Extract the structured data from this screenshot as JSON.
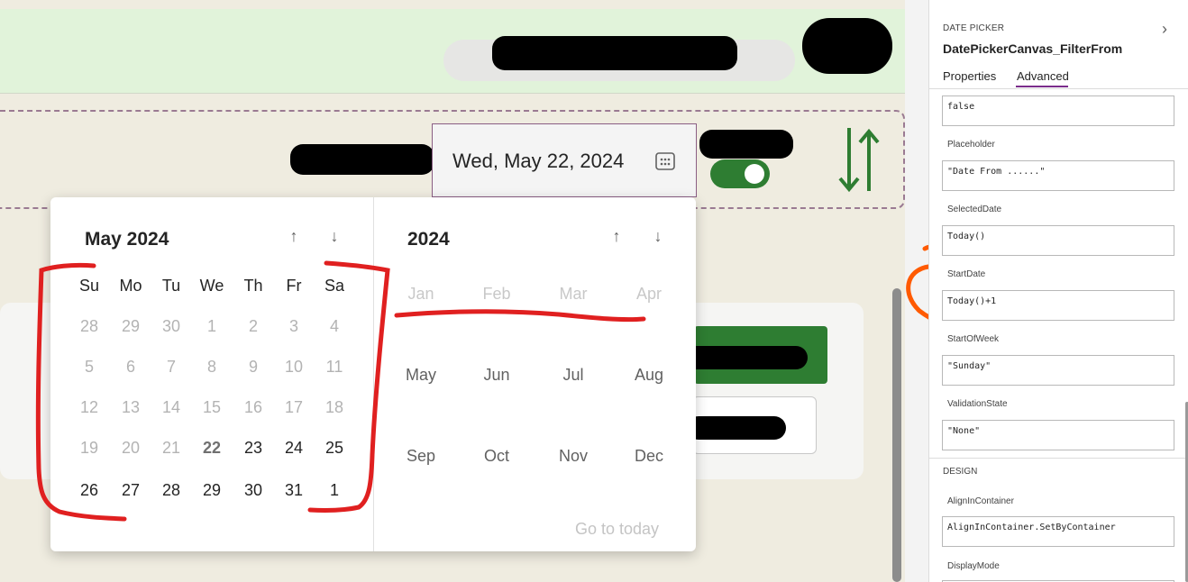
{
  "date_field": {
    "value": "Wed, May 22, 2024",
    "icon": "calendar-icon"
  },
  "calendar": {
    "month_header": "May 2024",
    "year_header": "2024",
    "weekdays": [
      "Su",
      "Mo",
      "Tu",
      "We",
      "Th",
      "Fr",
      "Sa"
    ],
    "weeks": [
      [
        "28",
        "29",
        "30",
        "1",
        "2",
        "3",
        "4"
      ],
      [
        "5",
        "6",
        "7",
        "8",
        "9",
        "10",
        "11"
      ],
      [
        "12",
        "13",
        "14",
        "15",
        "16",
        "17",
        "18"
      ],
      [
        "19",
        "20",
        "21",
        "22",
        "23",
        "24",
        "25"
      ],
      [
        "26",
        "27",
        "28",
        "29",
        "30",
        "31",
        "1"
      ]
    ],
    "months": [
      "Jan",
      "Feb",
      "Mar",
      "Apr",
      "May",
      "Jun",
      "Jul",
      "Aug",
      "Sep",
      "Oct",
      "Nov",
      "Dec"
    ],
    "go_today": "Go to today",
    "selected_day": "22"
  },
  "panel": {
    "control_type": "DATE PICKER",
    "control_name": "DatePickerCanvas_FilterFrom",
    "tabs": [
      "Properties",
      "Advanced"
    ],
    "active_tab": "Advanced",
    "first_value": "false",
    "properties": [
      {
        "label": "Placeholder",
        "value": "\"Date From ......\""
      },
      {
        "label": "SelectedDate",
        "value": "Today()"
      },
      {
        "label": "StartDate",
        "value": "Today()+1"
      },
      {
        "label": "StartOfWeek",
        "value": "\"Sunday\""
      },
      {
        "label": "ValidationState",
        "value": "\"None\""
      }
    ],
    "design_heading": "DESIGN",
    "design_properties": [
      {
        "label": "AlignInContainer",
        "value": "AlignInContainer.SetByContainer"
      },
      {
        "label": "DisplayMode",
        "value": ""
      }
    ]
  },
  "colors": {
    "accent": "#7b2d8b",
    "toggle_on": "#2e7d32",
    "disabled_text": "#b3b3b3",
    "annotation_red": "#e02020",
    "annotation_orange": "#ff5a00"
  }
}
